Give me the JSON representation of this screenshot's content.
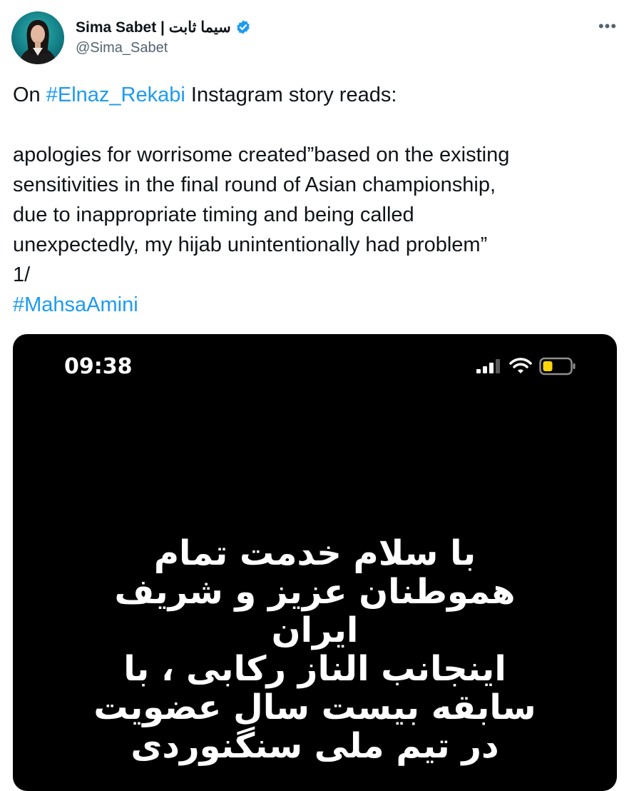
{
  "author": {
    "display_name": "Sima Sabet | سیما ثابت",
    "handle": "@Sima_Sabet",
    "verified_icon": "verified-badge-icon"
  },
  "menu": {
    "more_label": "•••"
  },
  "tweet": {
    "lines": [
      [
        {
          "text": "On ",
          "type": "text"
        },
        {
          "text": "#Elnaz_Rekabi",
          "type": "hashtag"
        },
        {
          "text": " Instagram story reads:",
          "type": "text"
        }
      ],
      [],
      [
        {
          "text": "apologies for worrisome created”based on the existing",
          "type": "text"
        }
      ],
      [
        {
          "text": "sensitivities in the final round of Asian championship,",
          "type": "text"
        }
      ],
      [
        {
          "text": "due to inappropriate timing and being called",
          "type": "text"
        }
      ],
      [
        {
          "text": "unexpectedly, my hijab unintentionally had problem”",
          "type": "text"
        }
      ],
      [
        {
          "text": "1/",
          "type": "text"
        }
      ],
      [
        {
          "text": "#MahsaAmini",
          "type": "hashtag"
        }
      ]
    ]
  },
  "media": {
    "status_time": "09:38",
    "story_lines": [
      "با سلام خدمت تمام",
      "هموطنان عزیز و شریف",
      "ایران",
      "اینجانب الناز رکابی ، با",
      "سابقه بیست سال عضویت",
      "در تیم ملی سنگنوردی"
    ]
  },
  "colors": {
    "text": "#0f1419",
    "secondary": "#536471",
    "link": "#1d9bf0",
    "verified": "#1d9bf0",
    "battery": "#ffd60a"
  }
}
